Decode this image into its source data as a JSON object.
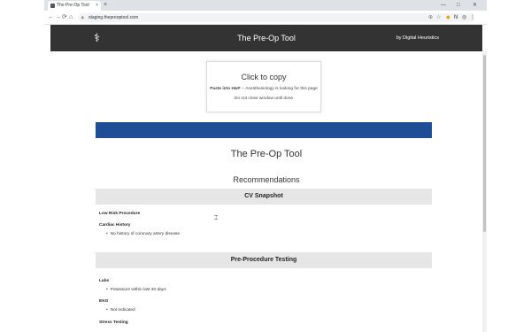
{
  "browser": {
    "tab_title": "The Pre-Op Tool",
    "tab_close": "×",
    "new_tab": "+",
    "window_controls": [
      "—",
      "□",
      "✕"
    ],
    "nav": [
      "←",
      "→",
      "⟳",
      "⌂"
    ],
    "url": "staging.thepreoptool.com",
    "extensions": [
      "⊕",
      "☆",
      "◆",
      "N",
      "◎",
      "⋮"
    ]
  },
  "header": {
    "logo": "⚕",
    "title": "The Pre-Op Tool",
    "byline": "by Digital Heuristics"
  },
  "copy_box": {
    "title": "Click to copy",
    "sub_bold": "Paste into H&P",
    "sub_rest": " -- Anesthesiology is looking for this page",
    "note": "Do not close window until done"
  },
  "page": {
    "heading": "The Pre-Op Tool",
    "subheading": "Recommendations"
  },
  "sections": [
    {
      "title": "CV Snapshot",
      "items": [
        {
          "label": "Low Risk Procedure",
          "bullets": []
        },
        {
          "label": "Cardiac History",
          "bullets": [
            "No history of coronary artery disease"
          ]
        }
      ]
    },
    {
      "title": "Pre-Procedure Testing",
      "items": [
        {
          "label": "Labs",
          "bullets": [
            "Potassium within last 30 days"
          ]
        },
        {
          "label": "EKG",
          "bullets": [
            "Not indicated"
          ]
        },
        {
          "label": "Stress Testing",
          "bullets": []
        }
      ]
    }
  ],
  "colors": {
    "header_bg": "#333333",
    "accent_blue": "#1f4e96",
    "section_bg": "#e6e6e6"
  }
}
